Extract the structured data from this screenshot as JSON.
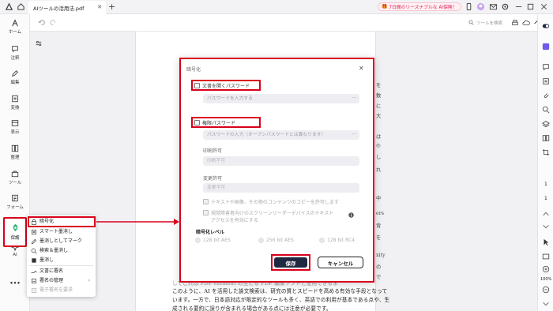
{
  "titlebar": {
    "tab_title": "AIツールの活用法.pdf",
    "promo_text": "7日間のリーズナブルな AI保険！"
  },
  "sidebar": {
    "items": [
      {
        "label": "ホーム",
        "icon": "home-icon"
      },
      {
        "label": "注釈",
        "icon": "comment-icon"
      },
      {
        "label": "編集",
        "icon": "edit-icon"
      },
      {
        "label": "変換",
        "icon": "convert-icon"
      },
      {
        "label": "表示",
        "icon": "view-icon"
      },
      {
        "label": "整理",
        "icon": "organize-icon"
      },
      {
        "label": "ツール",
        "icon": "tools-icon"
      },
      {
        "label": "フォーム",
        "icon": "form-icon"
      },
      {
        "label": "保護",
        "icon": "protect-icon"
      },
      {
        "label": "AI",
        "icon": "ai-icon"
      },
      {
        "label": "•••",
        "icon": "more-icon"
      }
    ]
  },
  "toolbar": {
    "search_placeholder": "ツールを検索"
  },
  "document": {
    "lines": [
      "このように、AI を活用した論文検索は、研究の質とスピードを高める有効な手段となって",
      "います。一方で、日本語対応が限定的なツールも多く、英語での利用が基本である点や、生",
      "成される要約に誤りが含まれる場合がある点には注意が必要です。"
    ],
    "top_partial": "してこれは PDF element の主たる PDF 編集ソフトと使用できるま",
    "side_chars_left": [
      "研",
      "な",
      "文",
      "発",
      "ツ",
      "ツ",
      "ル",
      "ル"
    ],
    "side_chars_right": [
      "を",
      "数",
      "に",
      "大",
      "は",
      "◎",
      "し",
      "れ",
      "中",
      "ers",
      "背",
      "を",
      "xity",
      "の",
      "で"
    ]
  },
  "dialog": {
    "title": "暗号化",
    "open_password_label": "文書を開くパスワード",
    "open_password_placeholder": "パスワードを入力する",
    "permission_password_label": "権限パスワード",
    "permission_password_placeholder": "パスワードの入力（オープンパスワードとは異なります）",
    "print_permission_label": "印刷許可",
    "print_permission_value": "印刷不可",
    "change_permission_label": "変更許可",
    "change_permission_value": "変更不可",
    "copy_option": "テキストや画像、その他のコンテンツのコピーを許可します",
    "screenreader_option_line1": "視覚障害者向けのスクリーンリーダーデバイスのテキスト",
    "screenreader_option_line2": "アクセスを有効にする",
    "encryption_level_label": "暗号化レベル",
    "levels": [
      "128 bit AES",
      "256 bit AES",
      "128 bit RC4"
    ],
    "save_button": "保存",
    "cancel_button": "キャンセル"
  },
  "popup_menu": {
    "items": [
      {
        "label": "暗号化",
        "icon": "lock-icon"
      },
      {
        "label": "スマート墨消し",
        "icon": "smart-redact-icon"
      },
      {
        "label": "墨消しとしてマーク",
        "icon": "mark-redact-icon"
      },
      {
        "label": "検索＆墨消し",
        "icon": "search-redact-icon"
      },
      {
        "label": "墨消し",
        "icon": "redact-icon"
      },
      {
        "label": "文書に署名",
        "icon": "sign-icon"
      },
      {
        "label": "署名の管理",
        "icon": "manage-signature-icon"
      },
      {
        "label": "電子署名を要求",
        "icon": "request-esign-icon"
      }
    ]
  },
  "rightbar": {
    "page_current": "1",
    "page_total": "1",
    "zoom": "100%"
  },
  "colors": {
    "accent_red": "#d9001b",
    "save_button_bg": "#1f2a40",
    "ai_green": "#2bb673"
  }
}
